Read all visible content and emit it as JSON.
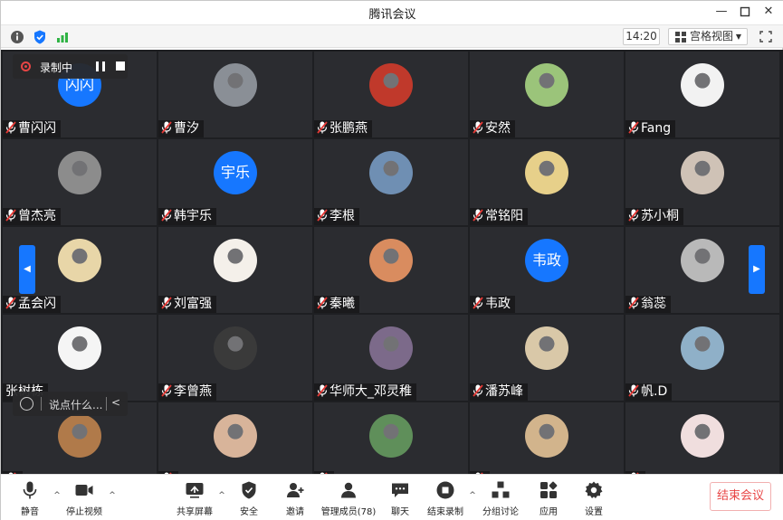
{
  "window": {
    "title": "腾讯会议"
  },
  "topbar": {
    "time": "14:20",
    "view_label": "宫格视图"
  },
  "recording": {
    "label": "录制中"
  },
  "chat": {
    "placeholder": "说点什么..."
  },
  "tiles": [
    {
      "name": "曹闪闪",
      "avatar_text": "闪闪",
      "avatar_color": "#1677ff"
    },
    {
      "name": "曹汐",
      "avatar_color": "#8a8f96"
    },
    {
      "name": "张鹏燕",
      "avatar_color": "#c0392b"
    },
    {
      "name": "安然",
      "avatar_color": "#9bc47a"
    },
    {
      "name": "Fang",
      "avatar_color": "#f2f2f2"
    },
    {
      "name": "曾杰亮",
      "avatar_color": "#8c8c8c"
    },
    {
      "name": "韩宇乐",
      "avatar_text": "宇乐",
      "avatar_color": "#1677ff"
    },
    {
      "name": "李根",
      "avatar_color": "#6f8fb3"
    },
    {
      "name": "常铭阳",
      "avatar_color": "#e7d08a"
    },
    {
      "name": "苏小桐",
      "avatar_color": "#cfc2b6"
    },
    {
      "name": "孟会闪",
      "avatar_color": "#e8d6a8"
    },
    {
      "name": "刘富强",
      "avatar_color": "#f4f0ea"
    },
    {
      "name": "秦曦",
      "avatar_color": "#d98c5f"
    },
    {
      "name": "韦政",
      "avatar_text": "韦政",
      "avatar_color": "#1677ff"
    },
    {
      "name": "翁蕊",
      "avatar_color": "#b9b9b9"
    },
    {
      "name": "张树栋",
      "avatar_color": "#f5f5f5",
      "no_mic": true
    },
    {
      "name": "李曾燕",
      "avatar_color": "#3a3a3a"
    },
    {
      "name": "华师大_邓灵稚",
      "avatar_color": "#7c6a8a"
    },
    {
      "name": "潘苏峰",
      "avatar_color": "#d9c8a8"
    },
    {
      "name": "帆.D",
      "avatar_color": "#8fb0c8"
    },
    {
      "name": "",
      "avatar_color": "#b07a4a"
    },
    {
      "name": "",
      "avatar_color": "#d8b49a"
    },
    {
      "name": "",
      "avatar_color": "#5f8f5a"
    },
    {
      "name": "",
      "avatar_color": "#d2b48c"
    },
    {
      "name": "",
      "avatar_color": "#f0dede"
    }
  ],
  "toolbar": {
    "items": [
      {
        "label": "静音",
        "icon": "mic-icon"
      },
      {
        "label": "停止视频",
        "icon": "camera-icon"
      },
      {
        "label": "共享屏幕",
        "icon": "share-screen-icon"
      },
      {
        "label": "安全",
        "icon": "shield-icon"
      },
      {
        "label": "邀请",
        "icon": "invite-icon"
      },
      {
        "label": "管理成员(78)",
        "icon": "members-icon"
      },
      {
        "label": "聊天",
        "icon": "chat-icon"
      },
      {
        "label": "结束录制",
        "icon": "record-stop-icon"
      },
      {
        "label": "分组讨论",
        "icon": "breakout-icon"
      },
      {
        "label": "应用",
        "icon": "apps-icon"
      },
      {
        "label": "设置",
        "icon": "gear-icon"
      }
    ],
    "end_label": "结束会议"
  },
  "colors": {
    "accent": "#1677ff",
    "danger": "#e84545",
    "tile_bg": "#2b2c30"
  }
}
